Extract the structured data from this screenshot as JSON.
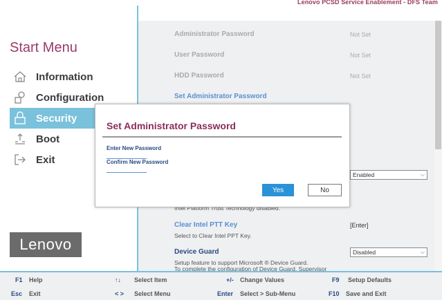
{
  "header": {
    "brand_text": "Lenovo PCSD Service Enablement - DFS Team"
  },
  "sidebar": {
    "title": "Start Menu",
    "items": [
      {
        "label": "Information",
        "icon": "home-icon"
      },
      {
        "label": "Configuration",
        "icon": "shapes-icon"
      },
      {
        "label": "Security",
        "icon": "lock-icon",
        "active": true
      },
      {
        "label": "Boot",
        "icon": "boot-icon"
      },
      {
        "label": "Exit",
        "icon": "exit-icon"
      }
    ],
    "logo_text": "Lenovo"
  },
  "main": {
    "admin_password": {
      "label": "Administrator Password",
      "value": "Not Set"
    },
    "user_password": {
      "label": "User Password",
      "value": "Not Set"
    },
    "hdd_password": {
      "label": "HDD Password",
      "value": "Not Set"
    },
    "set_admin_password": {
      "label": "Set Administrator Password"
    },
    "ptt_select": {
      "value": "Enabled"
    },
    "ptt_desc": "Intel Platform Trust Technology disabled.",
    "clear_ptt": {
      "label": "Clear Intel PTT Key",
      "value": "[Enter]",
      "desc": "Select to Clear Intel PPT Key."
    },
    "device_guard": {
      "label": "Device Guard",
      "value": "Disabled",
      "desc1": "Setup feature to support Microsoft ® Device Guard.",
      "desc2": "To complete the configuration of Device Guard, Supervisor"
    }
  },
  "dialog": {
    "title": "Set Administrator Password",
    "enter_label": "Enter New Password",
    "confirm_label": "Confirm New Password",
    "yes_label": "Yes",
    "no_label": "No"
  },
  "footer": {
    "row1": [
      {
        "key": "F1",
        "label": "Help"
      },
      {
        "key": "↑↓",
        "label": "Select Item"
      },
      {
        "key": "+/-",
        "label": "Change Values"
      },
      {
        "key": "F9",
        "label": "Setup Defaults"
      }
    ],
    "row2": [
      {
        "key": "Esc",
        "label": "Exit"
      },
      {
        "key": "< >",
        "label": "Select Menu"
      },
      {
        "key": "Enter",
        "label": "Select > Sub-Menu"
      },
      {
        "key": "F10",
        "label": "Save and Exit"
      }
    ]
  },
  "colors": {
    "accent": "#7ac1dc",
    "title": "#9a3b6a",
    "link": "#5b8fd0",
    "button": "#2a92d6"
  }
}
